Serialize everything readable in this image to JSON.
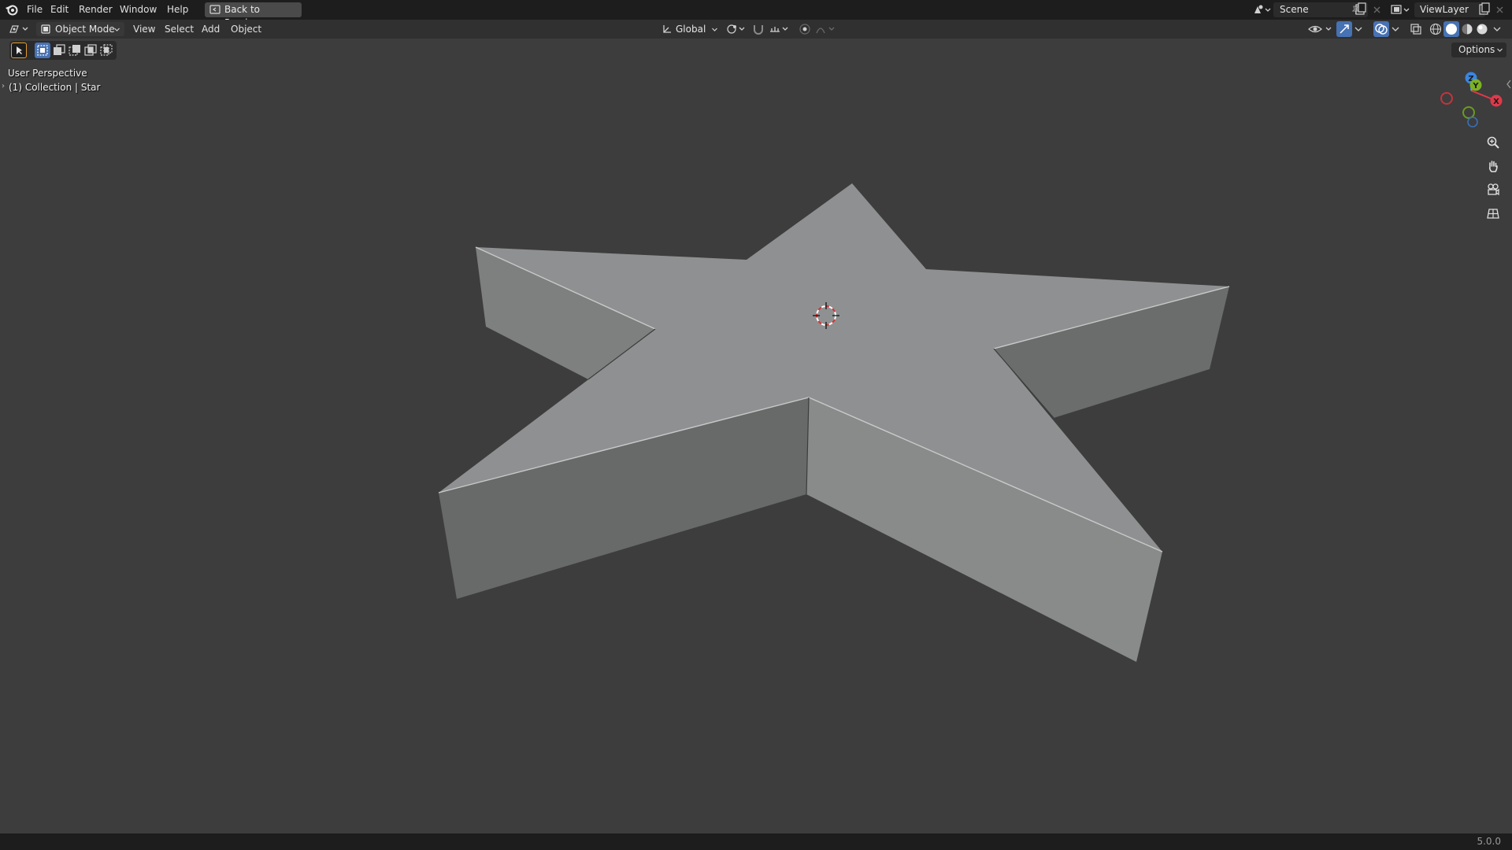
{
  "topbar": {
    "menus": [
      "File",
      "Edit",
      "Render",
      "Window",
      "Help"
    ],
    "back_label": "Back to Previous",
    "scene_label": "Scene",
    "viewlayer_label": "ViewLayer"
  },
  "viewport_header": {
    "mode_label": "Object Mode",
    "menus": [
      "View",
      "Select",
      "Add",
      "Object"
    ],
    "orientation_label": "Global"
  },
  "toolbar": {
    "options_label": "Options"
  },
  "overlay": {
    "perspective_label": "User Perspective",
    "collection_label": "(1) Collection | Star"
  },
  "gizmo": {
    "axes": [
      "Z",
      "Y",
      "X"
    ],
    "colors": {
      "x": "#e0394b",
      "y": "#7db124",
      "z": "#3a86e0"
    }
  },
  "statusbar": {
    "version": "5.0.0"
  },
  "scene": {
    "object_name": "Star",
    "viewport_bg": "#3d3d3d",
    "top_face_color": "#8f9091",
    "side_light_color": "#878888",
    "side_dark_color": "#6b6c6d"
  }
}
